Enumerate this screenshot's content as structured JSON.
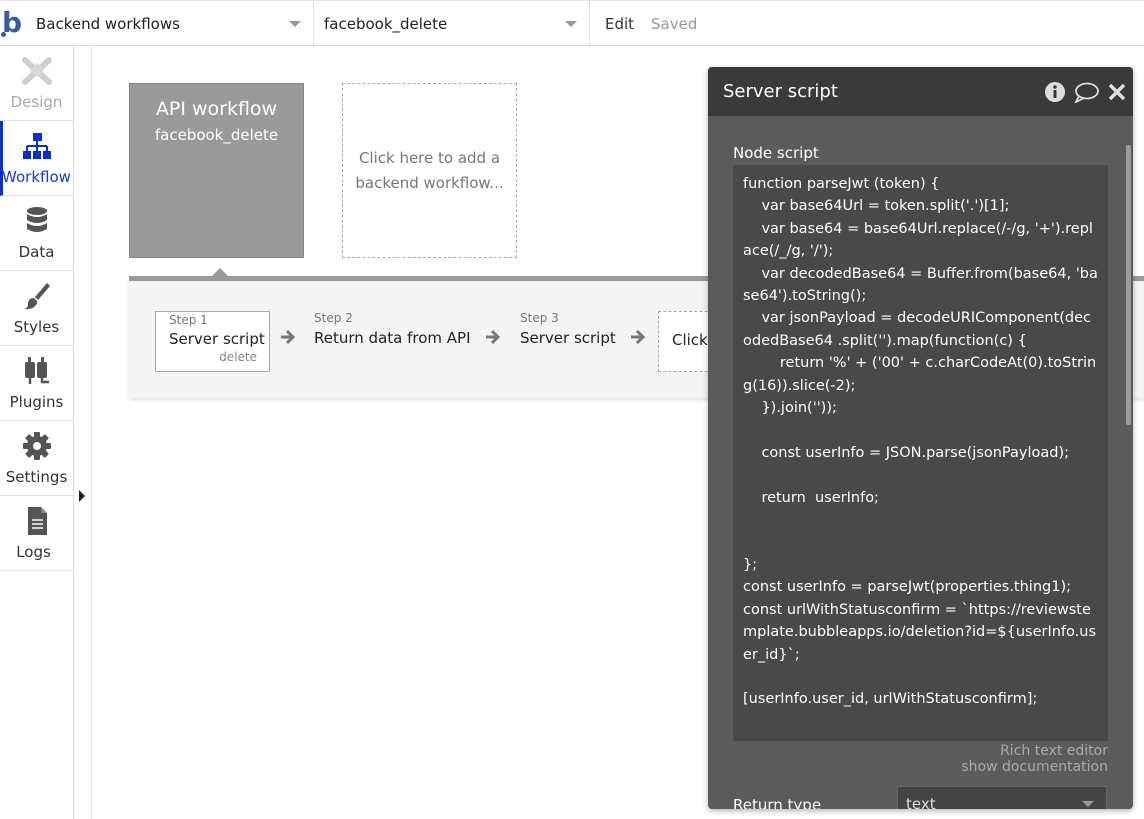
{
  "topbar": {
    "page_dropdown": "Backend workflows",
    "workflow_dropdown": "facebook_delete",
    "edit_label": "Edit",
    "saved_label": "Saved"
  },
  "sidebar": {
    "items": [
      {
        "label": "Design",
        "icon": "design-icon"
      },
      {
        "label": "Workflow",
        "icon": "workflow-icon"
      },
      {
        "label": "Data",
        "icon": "database-icon"
      },
      {
        "label": "Styles",
        "icon": "brush-icon"
      },
      {
        "label": "Plugins",
        "icon": "plug-icon"
      },
      {
        "label": "Settings",
        "icon": "gear-icon"
      },
      {
        "label": "Logs",
        "icon": "document-icon"
      }
    ]
  },
  "canvas": {
    "api_workflow": {
      "title": "API workflow",
      "name": "facebook_delete"
    },
    "add_workflow": {
      "line1": "Click here to add a",
      "line2": "backend workflow..."
    },
    "steps": [
      {
        "number": "Step 1",
        "name": "Server script",
        "sub": "delete"
      },
      {
        "number": "Step 2",
        "name": "Return data from API"
      },
      {
        "number": "Step 3",
        "name": "Server script"
      },
      {
        "name": "Click"
      }
    ]
  },
  "panel": {
    "title": "Server script",
    "node_label": "Node script",
    "code": "function parseJwt (token) {\n    var base64Url = token.split('.')[1];\n    var base64 = base64Url.replace(/-/g, '+').replace(/_/g, '/');\n    var decodedBase64 = Buffer.from(base64, 'base64').toString();\n    var jsonPayload = decodeURIComponent(decodedBase64 .split('').map(function(c) {\n        return '%' + ('00' + c.charCodeAt(0).toString(16)).slice(-2);\n    }).join(''));\n\n    const userInfo = JSON.parse(jsonPayload);\n\n    return  userInfo;\n\n\n};\nconst userInfo = parseJwt(properties.thing1);\nconst urlWithStatusconfirm = `https://reviewstemplate.bubbleapps.io/deletion?id=${userInfo.user_id}`;\n\n[userInfo.user_id, urlWithStatusconfirm];",
    "rich_text_editor": "Rich text editor",
    "show_documentation": "show documentation",
    "return_type_label": "Return type",
    "return_type_value": "text"
  },
  "colors": {
    "accent": "#1a3bd6",
    "panel_bg": "#5b5b5b",
    "panel_header": "#3a3a3a",
    "workflow_box": "#9a9a9a"
  }
}
